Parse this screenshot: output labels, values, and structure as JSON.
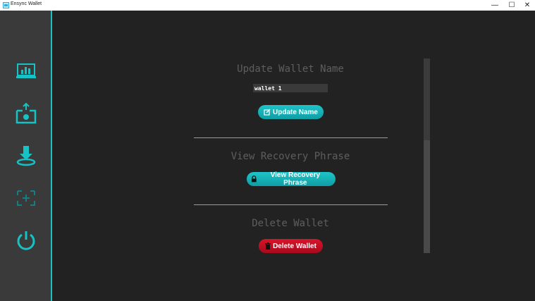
{
  "window": {
    "title": "Ensync Wallet",
    "minimize_glyph": "—",
    "maximize_glyph": "☐",
    "close_glyph": "✕"
  },
  "sidebar": {
    "accent_color": "#17c2c4",
    "items": [
      {
        "icon": "dashboard-chart-icon"
      },
      {
        "icon": "send-upload-icon"
      },
      {
        "icon": "receive-download-icon"
      },
      {
        "icon": "settings-wallet-icon"
      },
      {
        "icon": "power-icon"
      }
    ]
  },
  "update_name": {
    "title": "Update Wallet Name",
    "input_value": "wallet 1",
    "button_label": "Update Name"
  },
  "recovery": {
    "title": "View Recovery Phrase",
    "button_label": "View Recovery Phrase"
  },
  "delete": {
    "title": "Delete Wallet",
    "button_label": "Delete Wallet"
  }
}
